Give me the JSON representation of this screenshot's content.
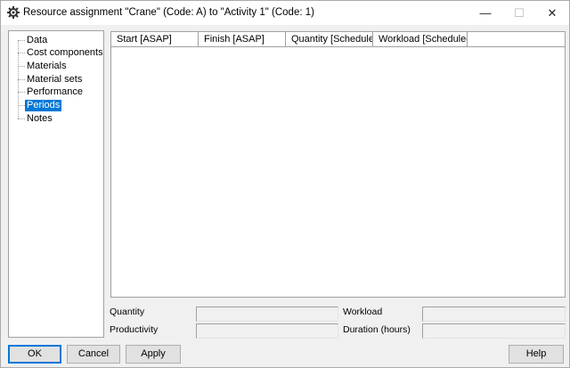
{
  "window": {
    "title": "Resource assignment \"Crane\" (Code: A) to \"Activity 1\" (Code: 1)",
    "controls": {
      "minimize": "—",
      "maximize": "☐",
      "close": "✕"
    }
  },
  "tree": {
    "items": [
      {
        "label": "Data"
      },
      {
        "label": "Cost components"
      },
      {
        "label": "Materials"
      },
      {
        "label": "Material sets"
      },
      {
        "label": "Performance"
      },
      {
        "label": "Periods",
        "selected": true
      },
      {
        "label": "Notes"
      }
    ]
  },
  "grid": {
    "columns": [
      "Start [ASAP]",
      "Finish [ASAP]",
      "Quantity [Schedule...",
      "Workload [Scheduled]"
    ],
    "rows": []
  },
  "fields": {
    "quantity_label": "Quantity",
    "productivity_label": "Productivity",
    "workload_label": "Workload",
    "duration_label": "Duration (hours)",
    "quantity_value": "",
    "productivity_value": "",
    "workload_value": "",
    "duration_value": ""
  },
  "buttons": {
    "ok": "OK",
    "cancel": "Cancel",
    "apply": "Apply",
    "help": "Help"
  }
}
